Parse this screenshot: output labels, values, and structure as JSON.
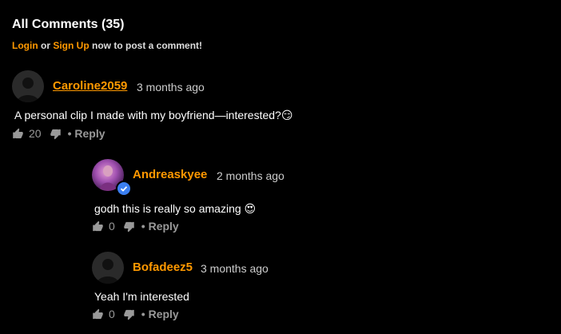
{
  "header": {
    "title": "All Comments (35)",
    "login": "Login",
    "or": "or",
    "signup": "Sign Up",
    "suffix": "now to post a comment!"
  },
  "comments": [
    {
      "username": "Caroline2059",
      "time": "3 months ago",
      "text": "A personal clip I made with my boyfriend—interested?😏",
      "likes": "20",
      "reply": "• Reply"
    },
    {
      "username": "Andreaskyee",
      "time": "2 months ago",
      "text": "godh this is really so amazing 😍",
      "likes": "0",
      "reply": "• Reply"
    },
    {
      "username": "Bofadeez5",
      "time": "3 months ago",
      "text": "Yeah I'm interested",
      "likes": "0",
      "reply": "• Reply"
    }
  ],
  "colors": {
    "accent": "#ff9900",
    "verified": "#3b7ff0"
  }
}
